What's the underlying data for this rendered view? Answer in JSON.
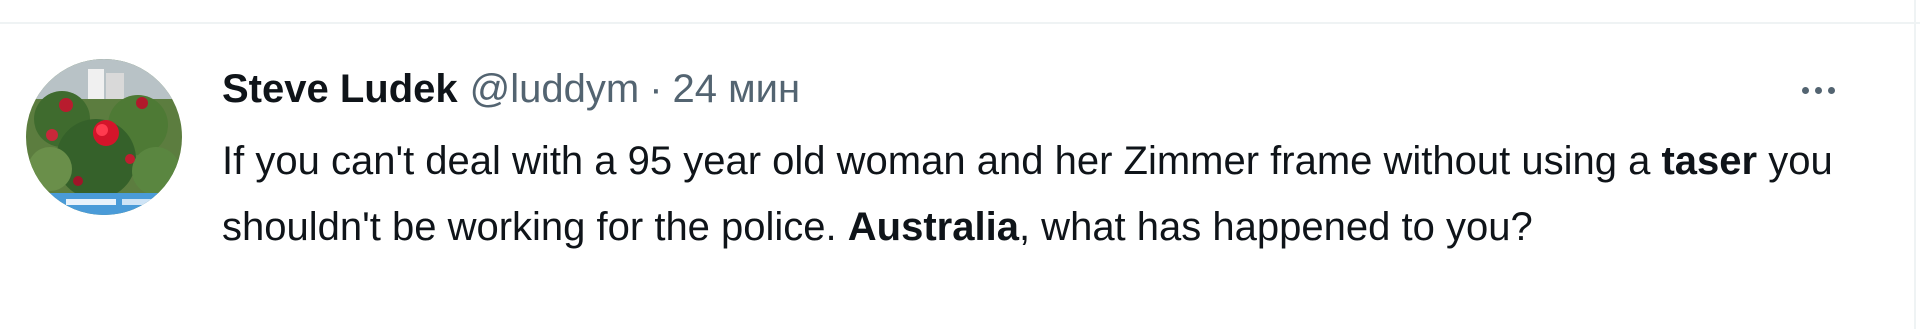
{
  "tweet": {
    "author": {
      "name": "Steve Ludek",
      "handle": "@luddym",
      "avatar_icon": "avatar-photo-red-roses"
    },
    "separator": "·",
    "timestamp": "24 мин",
    "more_icon": "more-horizontal-icon",
    "text_parts": {
      "p1": "If you can't deal with a 95 year old woman and her Zimmer frame without using a ",
      "bold1": "taser",
      "p2": " you shouldn't be working for the police. ",
      "bold2": "Australia",
      "p3": ", what has happened to you?"
    }
  },
  "colors": {
    "primary_text": "#0f1419",
    "secondary_text": "#536471",
    "border": "#eff3f4"
  }
}
